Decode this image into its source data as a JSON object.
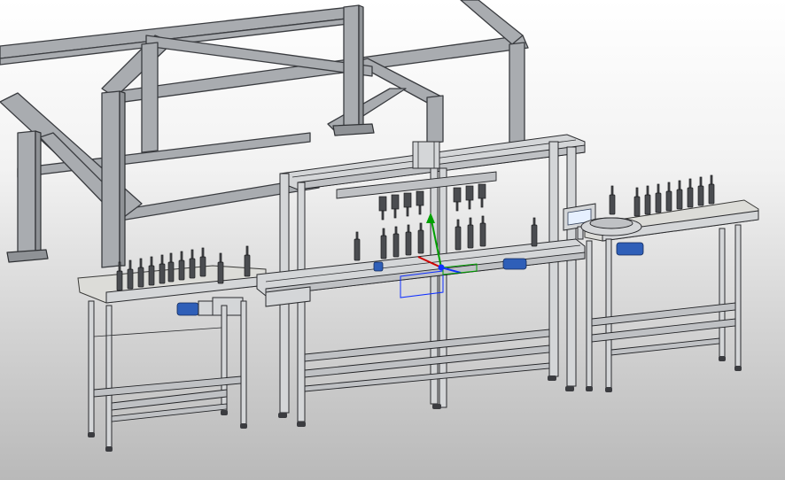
{
  "viewport": {
    "background_top": "#ffffff",
    "background_bottom": "#b9b9b9"
  },
  "model": {
    "colors": {
      "steel_frame": "#a9acb0",
      "aluminium_profile": "#d4d6d8",
      "motor": "#2f5fb8",
      "bottle": "#4a4c50",
      "hmi_screen": "#e6f0ff"
    },
    "icons": {
      "triad": "xyz-axis-triad-icon",
      "motor": "conveyor-motor-icon",
      "hmi": "touch-panel-icon"
    },
    "triad_axes": {
      "x_color": "#00a000",
      "y_color": "#d00000",
      "z_color": "#1030ff"
    }
  }
}
